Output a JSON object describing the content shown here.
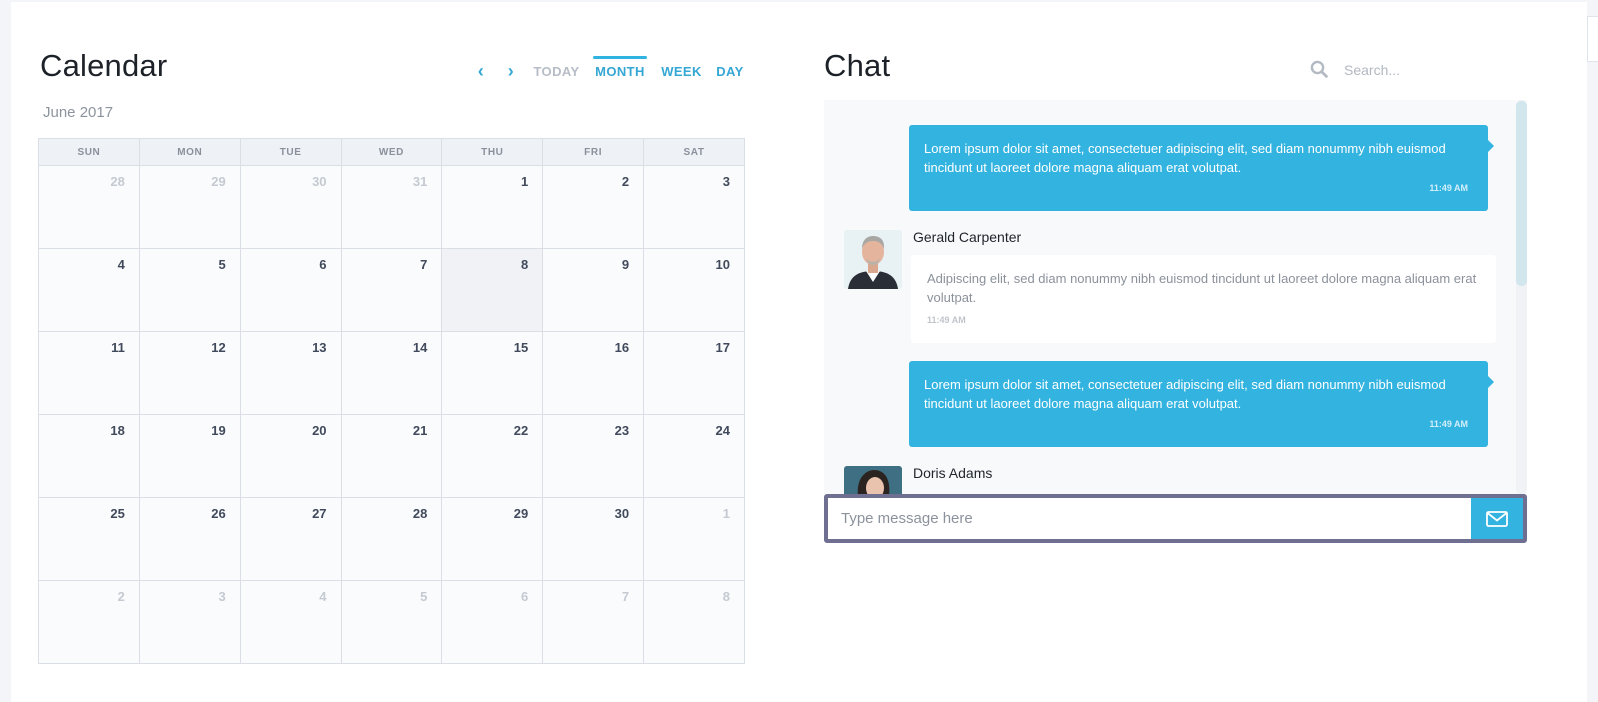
{
  "calendar": {
    "title": "Calendar",
    "nav": {
      "prev": "‹",
      "next": "›",
      "today": "TODAY",
      "month": "MONTH",
      "week": "WEEK",
      "day": "DAY",
      "active_view": "MONTH"
    },
    "month_label": "June 2017",
    "weekdays": [
      "SUN",
      "MON",
      "TUE",
      "WED",
      "THU",
      "FRI",
      "SAT"
    ],
    "weeks": [
      [
        {
          "d": "28",
          "m": true
        },
        {
          "d": "29",
          "m": true
        },
        {
          "d": "30",
          "m": true
        },
        {
          "d": "31",
          "m": true
        },
        {
          "d": "1"
        },
        {
          "d": "2"
        },
        {
          "d": "3"
        }
      ],
      [
        {
          "d": "4"
        },
        {
          "d": "5"
        },
        {
          "d": "6"
        },
        {
          "d": "7"
        },
        {
          "d": "8",
          "today": true
        },
        {
          "d": "9"
        },
        {
          "d": "10"
        }
      ],
      [
        {
          "d": "11"
        },
        {
          "d": "12"
        },
        {
          "d": "13"
        },
        {
          "d": "14"
        },
        {
          "d": "15"
        },
        {
          "d": "16"
        },
        {
          "d": "17"
        }
      ],
      [
        {
          "d": "18"
        },
        {
          "d": "19"
        },
        {
          "d": "20"
        },
        {
          "d": "21"
        },
        {
          "d": "22"
        },
        {
          "d": "23"
        },
        {
          "d": "24"
        }
      ],
      [
        {
          "d": "25"
        },
        {
          "d": "26"
        },
        {
          "d": "27"
        },
        {
          "d": "28"
        },
        {
          "d": "29"
        },
        {
          "d": "30"
        },
        {
          "d": "1",
          "m": true
        }
      ],
      [
        {
          "d": "2",
          "m": true
        },
        {
          "d": "3",
          "m": true
        },
        {
          "d": "4",
          "m": true
        },
        {
          "d": "5",
          "m": true
        },
        {
          "d": "6",
          "m": true
        },
        {
          "d": "7",
          "m": true
        },
        {
          "d": "8",
          "m": true
        }
      ]
    ]
  },
  "chat": {
    "title": "Chat",
    "search": {
      "placeholder": "Search...",
      "icon": "search-icon"
    },
    "messages": [
      {
        "type": "out",
        "text": "Lorem ipsum dolor sit amet, consectetuer adipiscing elit, sed diam nonummy nibh euismod tincidunt ut laoreet dolore magna aliquam erat volutpat.",
        "time": "11:49 AM"
      },
      {
        "type": "in",
        "sender": "Gerald Carpenter",
        "text": "Adipiscing elit, sed diam nonummy nibh euismod tincidunt ut laoreet dolore magna aliquam erat volutpat.",
        "time": "11:49 AM"
      },
      {
        "type": "out",
        "text": "Lorem ipsum dolor sit amet, consectetuer adipiscing elit, sed diam nonummy nibh euismod tincidunt ut laoreet dolore magna aliquam erat volutpat.",
        "time": "11:49 AM"
      },
      {
        "type": "in",
        "sender": "Doris Adams"
      }
    ],
    "compose": {
      "placeholder": "Type message here",
      "send_icon": "envelope-icon"
    }
  },
  "colors": {
    "accent": "#33b3e0",
    "nav_link": "#35a7d4",
    "compose_border": "#6f6f92"
  }
}
